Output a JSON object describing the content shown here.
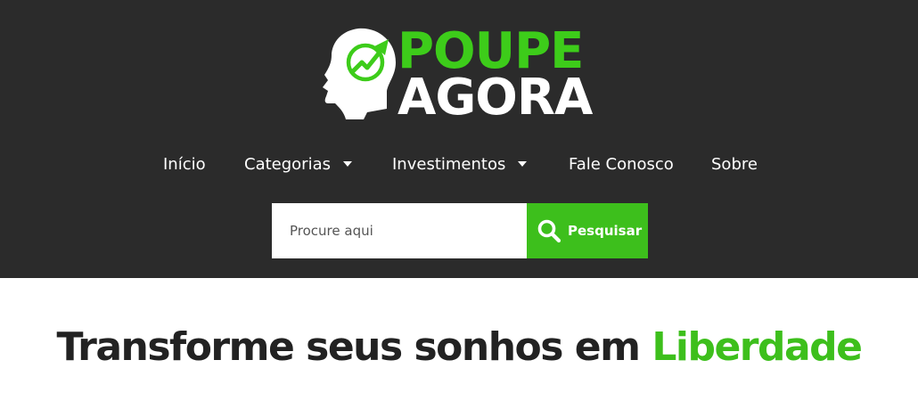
{
  "brand": {
    "name_top": "POUPE",
    "name_bottom": "AGORA",
    "primary_color": "#3dcc1a",
    "header_background": "#2b2b2b",
    "icon": "head-growth-arrow-logo-icon"
  },
  "nav": {
    "items": [
      {
        "label": "Início",
        "has_dropdown": false
      },
      {
        "label": "Categorias",
        "has_dropdown": true
      },
      {
        "label": "Investimentos",
        "has_dropdown": true
      },
      {
        "label": "Fale Conosco",
        "has_dropdown": false
      },
      {
        "label": "Sobre",
        "has_dropdown": false
      }
    ]
  },
  "search": {
    "placeholder": "Procure aqui",
    "value": "",
    "button_label": "Pesquisar",
    "button_color": "#3dbf1c",
    "icon": "search-icon"
  },
  "hero": {
    "title_prefix": "Transforme seus sonhos em",
    "title_highlight": "Liberdade"
  }
}
